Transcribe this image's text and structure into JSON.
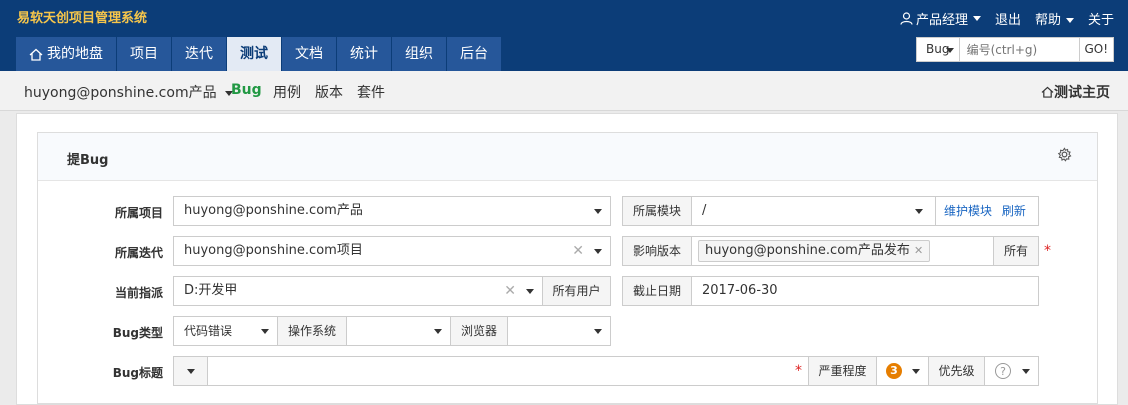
{
  "header": {
    "app_title": "易软天创项目管理系统",
    "user_menu": "产品经理",
    "logout": "退出",
    "help": "帮助",
    "about": "关于"
  },
  "nav": {
    "tabs": [
      {
        "label": "我的地盘",
        "icon": "home-icon"
      },
      {
        "label": "项目"
      },
      {
        "label": "迭代"
      },
      {
        "label": "测试",
        "active": true
      },
      {
        "label": "文档"
      },
      {
        "label": "统计"
      },
      {
        "label": "组织"
      },
      {
        "label": "后台"
      }
    ]
  },
  "search": {
    "type": "Bug",
    "placeholder": "编号(ctrl+g)",
    "go": "GO!"
  },
  "subnav": {
    "product": "huyong@ponshine.com产品",
    "bug": "Bug",
    "case": "用例",
    "version": "版本",
    "suite": "套件",
    "home": "测试主页"
  },
  "form": {
    "title": "提Bug",
    "project_label": "所属项目",
    "project_value": "huyong@ponshine.com产品",
    "module_label": "所属模块",
    "module_value": "/",
    "maintain_module": "维护模块",
    "refresh": "刷新",
    "iteration_label": "所属迭代",
    "iteration_value": "huyong@ponshine.com项目",
    "affected_version_label": "影响版本",
    "affected_version_chip": "huyong@ponshine.com产品发布",
    "all_button": "所有",
    "assign_label": "当前指派",
    "assign_value": "D:开发甲",
    "all_users_button": "所有用户",
    "deadline_label": "截止日期",
    "deadline_value": "2017-06-30",
    "bug_type_label": "Bug类型",
    "bug_type_value": "代码错误",
    "os_label": "操作系统",
    "os_value": "",
    "browser_label": "浏览器",
    "browser_value": "",
    "bug_title_label": "Bug标题",
    "bug_title_value": "",
    "severity_label": "严重程度",
    "severity_value": "3",
    "priority_label": "优先级",
    "priority_value": "?"
  },
  "colors": {
    "topbar": "#0c3d78",
    "title": "#f6c64b",
    "nav_tab": "#26579a",
    "active_sub": "#229944",
    "link": "#1a66c2",
    "severity": "#e67e00"
  }
}
